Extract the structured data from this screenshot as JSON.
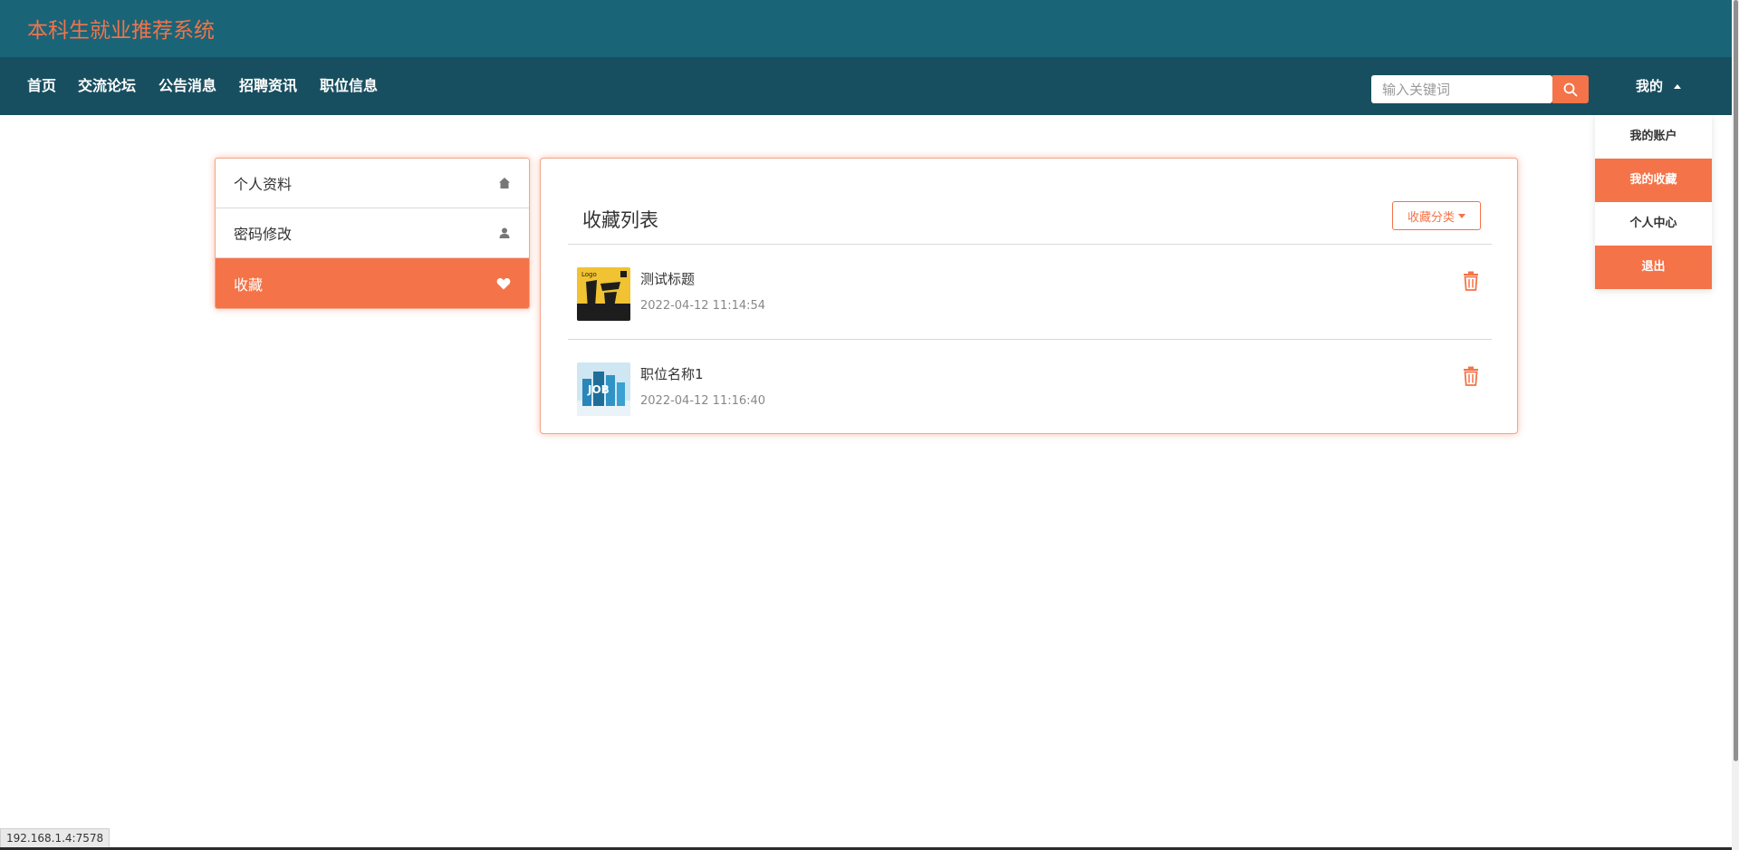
{
  "header": {
    "site_title": "本科生就业推荐系统"
  },
  "nav": {
    "items": [
      {
        "label": "首页"
      },
      {
        "label": "交流论坛"
      },
      {
        "label": "公告消息"
      },
      {
        "label": "招聘资讯"
      },
      {
        "label": "职位信息"
      }
    ],
    "search": {
      "placeholder": "输入关键词",
      "value": ""
    },
    "me_label": "我的"
  },
  "dropdown": {
    "items": [
      {
        "label": "我的账户"
      },
      {
        "label": "我的收藏"
      },
      {
        "label": "个人中心"
      },
      {
        "label": "退出"
      }
    ]
  },
  "side_menu": {
    "items": [
      {
        "label": "个人资料",
        "icon": "home-icon"
      },
      {
        "label": "密码修改",
        "icon": "user-icon"
      },
      {
        "label": "收藏",
        "icon": "heart-icon"
      }
    ]
  },
  "favorites": {
    "title": "收藏列表",
    "category_button": "收藏分类",
    "items": [
      {
        "title": "测试标题",
        "time": "2022-04-12 11:14:54"
      },
      {
        "title": "职位名称1",
        "time": "2022-04-12 11:16:40"
      }
    ]
  },
  "status_bar": {
    "url": "192.168.1.4:7578"
  },
  "colors": {
    "accent": "#f47348",
    "topbar": "#1a6478",
    "navbar": "#184f60"
  }
}
